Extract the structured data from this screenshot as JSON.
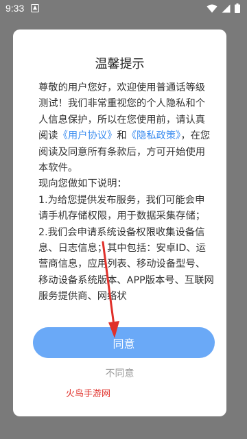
{
  "status_bar": {
    "time": "9:33"
  },
  "dialog": {
    "title": "温馨提示",
    "body": {
      "intro_before_link1": "尊敬的用户您好，欢迎使用普通话等级测试！我们非常重视您的个人隐私和个人信息保护，所以在您使用前，请认真阅读",
      "link_user_agreement": "《用户协议》",
      "and_text": "和",
      "link_privacy_policy": "《隐私政策》",
      "intro_after_links": "，在您阅读及同意所有条款后，方可开始使用本软件。",
      "explain_heading": "现向您做如下说明：",
      "point_1": "1.为给您提供发布服务，我们可能会申请手机存储权限，用于数据采集存储；",
      "point_2": "2.我们会申请系统设备权限收集设备信息、日志信息；其中包括：安卓ID、运营商信息，应用列表、移动设备型号、移动设备系统版本、APP版本号、互联网服务提供商、网络状"
    },
    "agree_label": "同意",
    "disagree_label": "不同意"
  },
  "watermark": "火鸟手游网",
  "colors": {
    "accent_button": "#6aa9f7",
    "link": "#3d8ef0",
    "annotation_arrow": "#e0302a",
    "overlay": "#7a7a7a"
  },
  "icons": [
    "notification-a-icon",
    "wifi-icon",
    "cellular-signal-icon",
    "battery-icon"
  ]
}
